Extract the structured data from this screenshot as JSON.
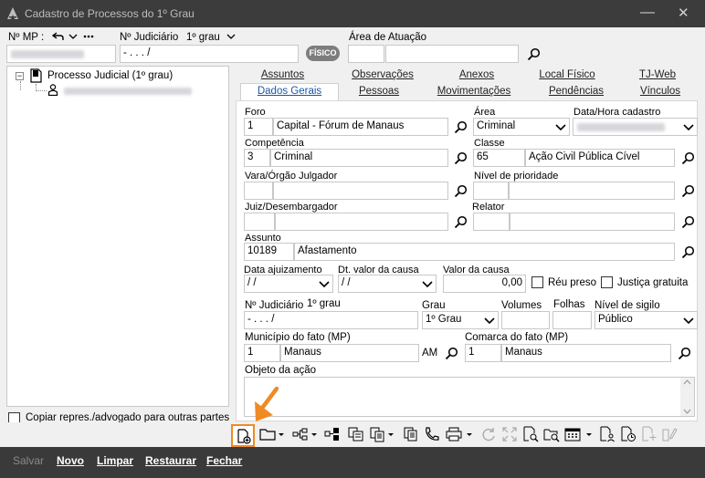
{
  "window": {
    "title": "Cadastro de Processos do 1º Grau",
    "minimize": "—",
    "close": "✕"
  },
  "top": {
    "nmp_label": "Nº MP :",
    "num_judiciario_label": "Nº Judiciário",
    "grau_label": "1º grau",
    "num_judiciario_value": "  -  .   .  .   /  ",
    "fisico_badge": "FÍSICO",
    "area_atuacao_label": "Área de Atuação"
  },
  "tree": {
    "root": "Processo Judicial (1º grau)",
    "expander": "−"
  },
  "tabs_row1": [
    "Assuntos",
    "Observações",
    "Anexos",
    "Local Físico",
    "TJ-Web"
  ],
  "tabs_row2": [
    "Dados Gerais",
    "Pessoas",
    "Movimentações",
    "Pendências",
    "Vínculos"
  ],
  "form": {
    "foro_label": "Foro",
    "foro_code": "1",
    "foro_value": "Capital - Fórum de Manaus",
    "area_label": "Área",
    "area_value": "Criminal",
    "data_cad_label": "Data/Hora cadastro",
    "competencia_label": "Competência",
    "competencia_code": "3",
    "competencia_value": "Criminal",
    "classe_label": "Classe",
    "classe_code": "65",
    "classe_value": "Ação Civil Pública Cível",
    "vara_label": "Vara/Órgão Julgador",
    "nivel_prio_label": "Nível de prioridade",
    "juiz_label": "Juiz/Desembargador",
    "relator_label": "Relator",
    "assunto_label": "Assunto",
    "assunto_code": "10189",
    "assunto_value": "Afastamento",
    "data_ajuiz_label": "Data ajuizamento",
    "data_ajuiz_value": " /  /",
    "dt_valor_label": "Dt. valor da causa",
    "dt_valor_value": " /  /",
    "valor_causa_label": "Valor da causa",
    "valor_causa_value": "0,00",
    "reu_preso_label": "Réu preso",
    "justica_gratuita_label": "Justiça gratuita",
    "num_jud_label": "Nº Judiciário",
    "num_jud_grau": "1º grau",
    "num_jud_value": "  -  .   .  .   /",
    "grau_label": "Grau",
    "grau_value": "1º Grau",
    "volumes_label": "Volumes",
    "folhas_label": "Folhas",
    "sigilo_label": "Nível de sigilo",
    "sigilo_value": "Público",
    "municipio_label": "Município do fato (MP)",
    "municipio_code": "1",
    "municipio_value": "Manaus",
    "municipio_uf": "AM",
    "comarca_label": "Comarca do fato (MP)",
    "comarca_code": "1",
    "comarca_value": "Manaus",
    "objeto_label": "Objeto da ação"
  },
  "copy_checkbox_label": "Copiar repres./advogado para outras partes",
  "bottom": {
    "salvar": "Salvar",
    "novo": "Novo",
    "limpar": "Limpar",
    "restaurar": "Restaurar",
    "fechar": "Fechar"
  },
  "colors": {
    "titlebar": "#3c3c3c",
    "active_tab_text": "#1a56a6",
    "highlight": "#f08a24",
    "bottombar": "#3a3a3a"
  }
}
